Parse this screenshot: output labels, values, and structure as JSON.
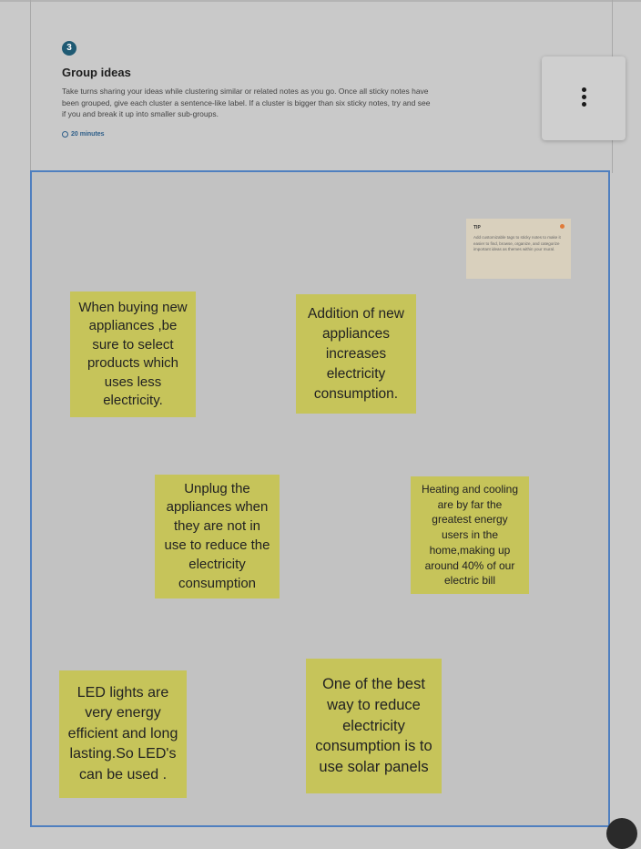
{
  "step": {
    "number": "3",
    "title": "Group ideas",
    "description": "Take turns sharing your ideas while clustering similar or related notes as you go. Once all sticky notes have been grouped, give each cluster a sentence-like label. If a cluster is bigger than six sticky notes, try and see if you and break it up into smaller sub-groups.",
    "duration": "20 minutes"
  },
  "tip": {
    "label": "TIP",
    "text": "Add customizable tags to sticky notes to make it easier to find, browse, organize, and categorize important ideas as themes within your mural."
  },
  "notes": [
    {
      "text": "When buying new\nappliances ,be\nsure to select\nproducts which\nuses less\nelectricity."
    },
    {
      "text": "Addition of new\nappliances\nincreases\nelectricity\nconsumption."
    },
    {
      "text": "Unplug the\nappliances when\nthey are not in\nuse to reduce the\nelectricity\nconsumption"
    },
    {
      "text": "Heating and cooling\nare by far the\ngreatest energy\nusers in the\nhome,making up\naround 40% of our\nelectric bill"
    },
    {
      "text": "LED lights are\nvery energy\nefficient and long\nlasting.So LED's\ncan be used ."
    },
    {
      "text": "One of the best\nway to reduce\nelectricity\nconsumption is to\nuse solar panels"
    }
  ],
  "colors": {
    "sticky_note": "#c6c45a",
    "board_border": "#4f7fbf",
    "step_badge": "#1f5a73"
  }
}
